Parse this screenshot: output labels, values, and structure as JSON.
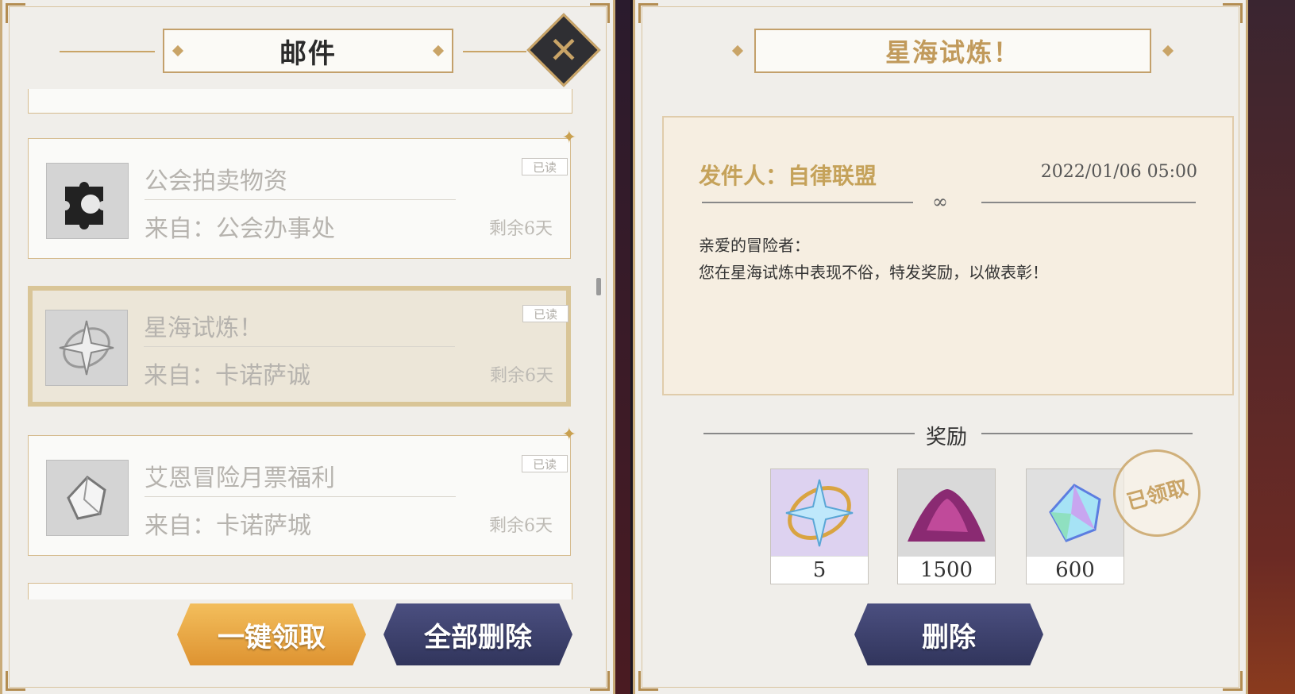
{
  "mail_panel": {
    "title": "邮件",
    "items": [
      {
        "title": "公会拍卖物资",
        "from": "来自：公会办事处",
        "remaining": "剩余6天",
        "read": "已读",
        "icon": "guild-puzzle-icon"
      },
      {
        "title": "星海试炼！",
        "from": "来自：卡诺萨诚",
        "remaining": "剩余6天",
        "read": "已读",
        "icon": "compass-star-icon"
      },
      {
        "title": "艾恩冒险月票福利",
        "from": "来自：卡诺萨城",
        "remaining": "剩余6天",
        "read": "已读",
        "icon": "crystal-icon"
      }
    ],
    "claim_all_label": "一键领取",
    "delete_all_label": "全部删除"
  },
  "detail_panel": {
    "title": "星海试炼！",
    "sender": "发件人：自律联盟",
    "date": "2022/01/06 05:00",
    "body_line1": "亲爱的冒险者：",
    "body_line2": "您在星海试炼中表现不俗，特发奖励，以做表彰！",
    "rewards_label": "奖励",
    "rewards": [
      {
        "icon": "star-compass-icon",
        "count": "5"
      },
      {
        "icon": "purple-sand-icon",
        "count": "1500"
      },
      {
        "icon": "rainbow-crystal-icon",
        "count": "600"
      }
    ],
    "claimed_stamp": "已领取",
    "delete_label": "删除"
  },
  "colors": {
    "gold": "#c3a06b",
    "claim_orange": "#e8a545",
    "navy": "#3b3f6b",
    "selected_bg": "#ece6d8"
  }
}
